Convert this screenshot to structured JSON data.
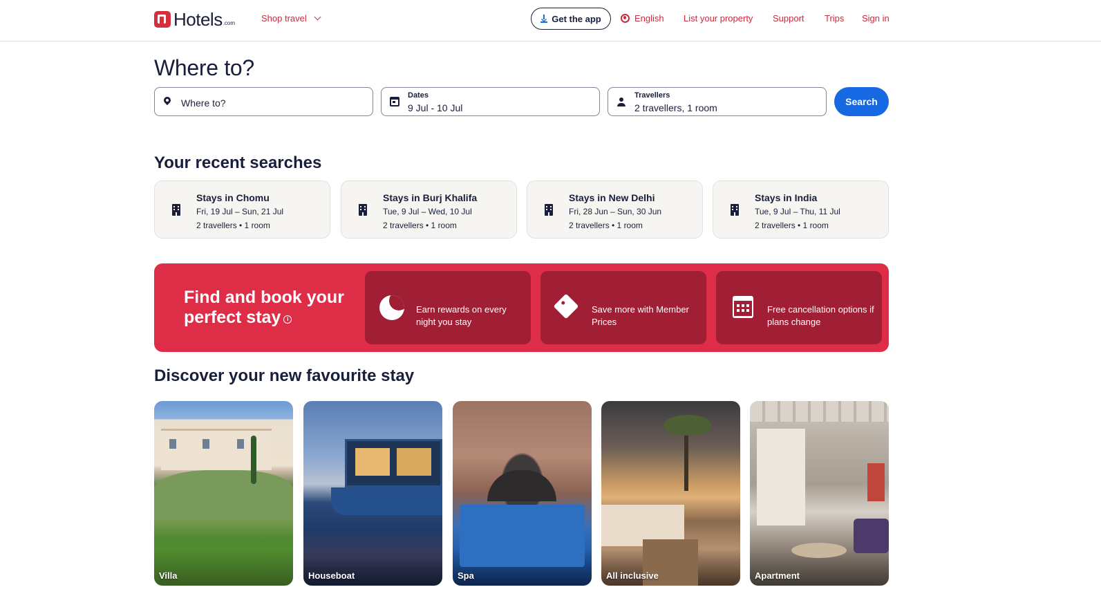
{
  "header": {
    "logo_text": "Hotels",
    "logo_suffix": ".com",
    "shop_travel": "Shop travel",
    "get_app": "Get the app",
    "language": "English",
    "list_property": "List your property",
    "support": "Support",
    "trips": "Trips",
    "sign_in": "Sign in"
  },
  "search": {
    "heading": "Where to?",
    "destination_placeholder": "Where to?",
    "dates_label": "Dates",
    "dates_value": "9 Jul - 10 Jul",
    "travellers_label": "Travellers",
    "travellers_value": "2 travellers, 1 room",
    "button": "Search"
  },
  "recent": {
    "heading": "Your recent searches",
    "items": [
      {
        "title": "Stays in Chomu",
        "dates": "Fri, 19 Jul – Sun, 21 Jul",
        "travellers": "2 travellers • 1 room"
      },
      {
        "title": "Stays in Burj Khalifa",
        "dates": "Tue, 9 Jul – Wed, 10 Jul",
        "travellers": "2 travellers • 1 room"
      },
      {
        "title": "Stays in New Delhi",
        "dates": "Fri, 28 Jun – Sun, 30 Jun",
        "travellers": "2 travellers • 1 room"
      },
      {
        "title": "Stays in India",
        "dates": "Tue, 9 Jul – Thu, 11 Jul",
        "travellers": "2 travellers • 1 room"
      }
    ]
  },
  "promo": {
    "title": "Find and book your perfect stay",
    "cards": [
      {
        "icon": "moon-icon",
        "text": "Earn rewards on every night you stay"
      },
      {
        "icon": "tag-icon",
        "text": "Save more with Member Prices"
      },
      {
        "icon": "calendar-icon",
        "text": "Free cancellation options if plans change"
      }
    ]
  },
  "discover": {
    "heading": "Discover your new favourite stay",
    "items": [
      {
        "label": "Villa"
      },
      {
        "label": "Houseboat"
      },
      {
        "label": "Spa"
      },
      {
        "label": "All inclusive"
      },
      {
        "label": "Apartment"
      }
    ]
  },
  "colors": {
    "brand_red": "#d32f3f",
    "link_red": "#c72c3e",
    "search_blue": "#1668e3",
    "promo_red": "#de2d46",
    "promo_card": "#a01f34",
    "recent_card_bg": "#f7f5f1"
  }
}
